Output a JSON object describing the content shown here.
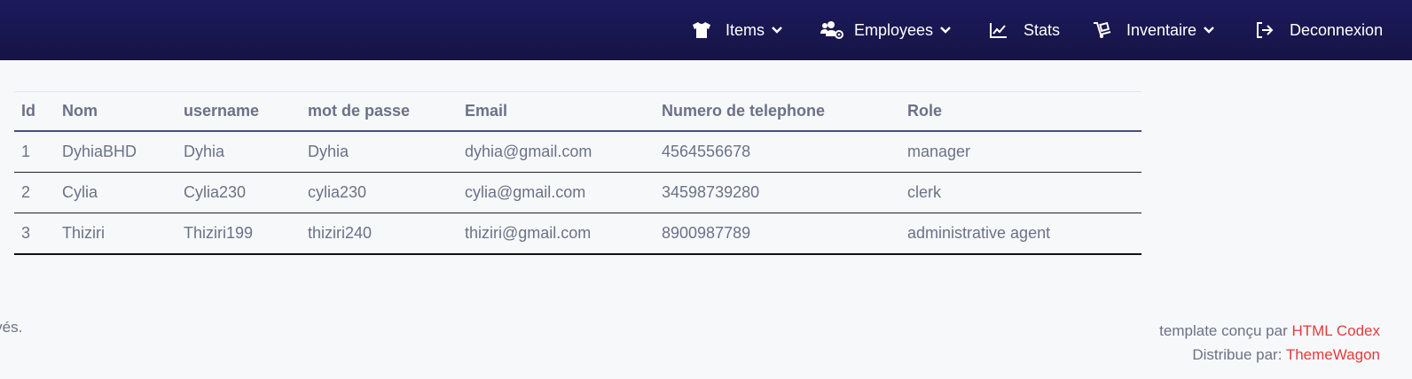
{
  "nav": {
    "items": [
      {
        "label": "Items",
        "icon": "tshirt-icon",
        "has_dropdown": true
      },
      {
        "label": "Employees",
        "icon": "users-cog-icon",
        "has_dropdown": true
      },
      {
        "label": "Stats",
        "icon": "chart-line-icon",
        "has_dropdown": false
      },
      {
        "label": "Inventaire",
        "icon": "dolly-icon",
        "has_dropdown": true
      },
      {
        "label": "Deconnexion",
        "icon": "sign-out-icon",
        "has_dropdown": false
      }
    ]
  },
  "table": {
    "headers": [
      "Id",
      "Nom",
      "username",
      "mot de passe",
      "Email",
      "Numero de telephone",
      "Role"
    ],
    "rows": [
      [
        "1",
        "DyhiaBHD",
        "Dyhia",
        "Dyhia",
        "dyhia@gmail.com",
        "4564556678",
        "manager"
      ],
      [
        "2",
        "Cylia",
        "Cylia230",
        "cylia230",
        "cylia@gmail.com",
        "34598739280",
        "clerk"
      ],
      [
        "3",
        "Thiziri",
        "Thiziri199",
        "thiziri240",
        "thiziri@gmail.com",
        "8900987789",
        "administrative agent"
      ]
    ]
  },
  "footer": {
    "left_text": "t réservés.",
    "template_prefix": "template conçu par ",
    "template_link": "HTML Codex",
    "distrib_prefix": "Distribue par: ",
    "distrib_link": "ThemeWagon"
  },
  "colors": {
    "navbar": "#1c1a5c",
    "link": "#e43b3b",
    "text": "#6b7287"
  }
}
